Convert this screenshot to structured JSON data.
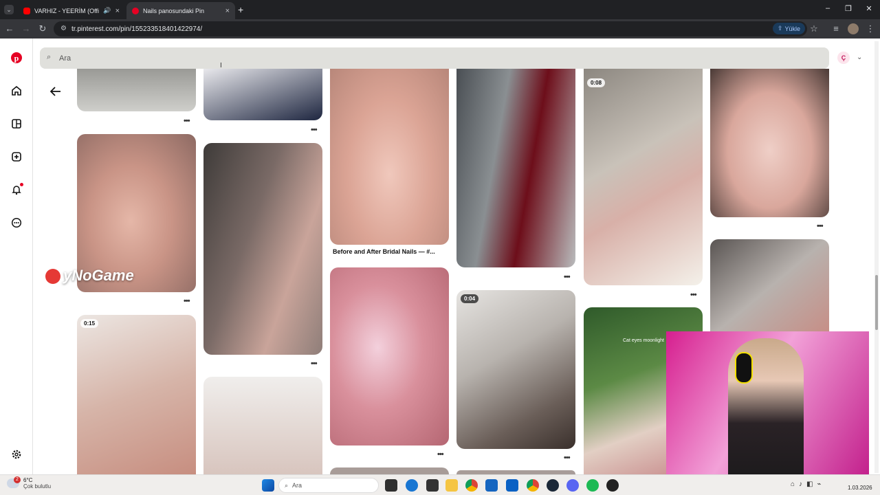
{
  "browser": {
    "tabs": [
      {
        "title": "VARHIZ - YEERİM (Official I",
        "active": false
      },
      {
        "title": "Nails panosundaki Pin",
        "active": true
      }
    ],
    "url": "tr.pinterest.com/pin/155233518401422974/",
    "upload_label": "Yükle"
  },
  "pinterest": {
    "search_placeholder": "Ara",
    "avatar_initial": "Ç",
    "pin_caption": "Before and After Bridal Nails — #...",
    "video_badges": [
      "0:08",
      "0:04",
      "0:15"
    ],
    "pin_overlay_text": "Cat eyes moonlight"
  },
  "overlay": {
    "logo_text": "yNoGame"
  },
  "taskbar": {
    "weather_temp": "6°C",
    "weather_desc": "Çok bulutlu",
    "weather_badge": "2",
    "search_label": "Ara",
    "date": "1.03.2026"
  },
  "colors": {
    "pinterest_red": "#e60023",
    "tab_bg": "#202124",
    "toolbar_bg": "#35363a"
  }
}
